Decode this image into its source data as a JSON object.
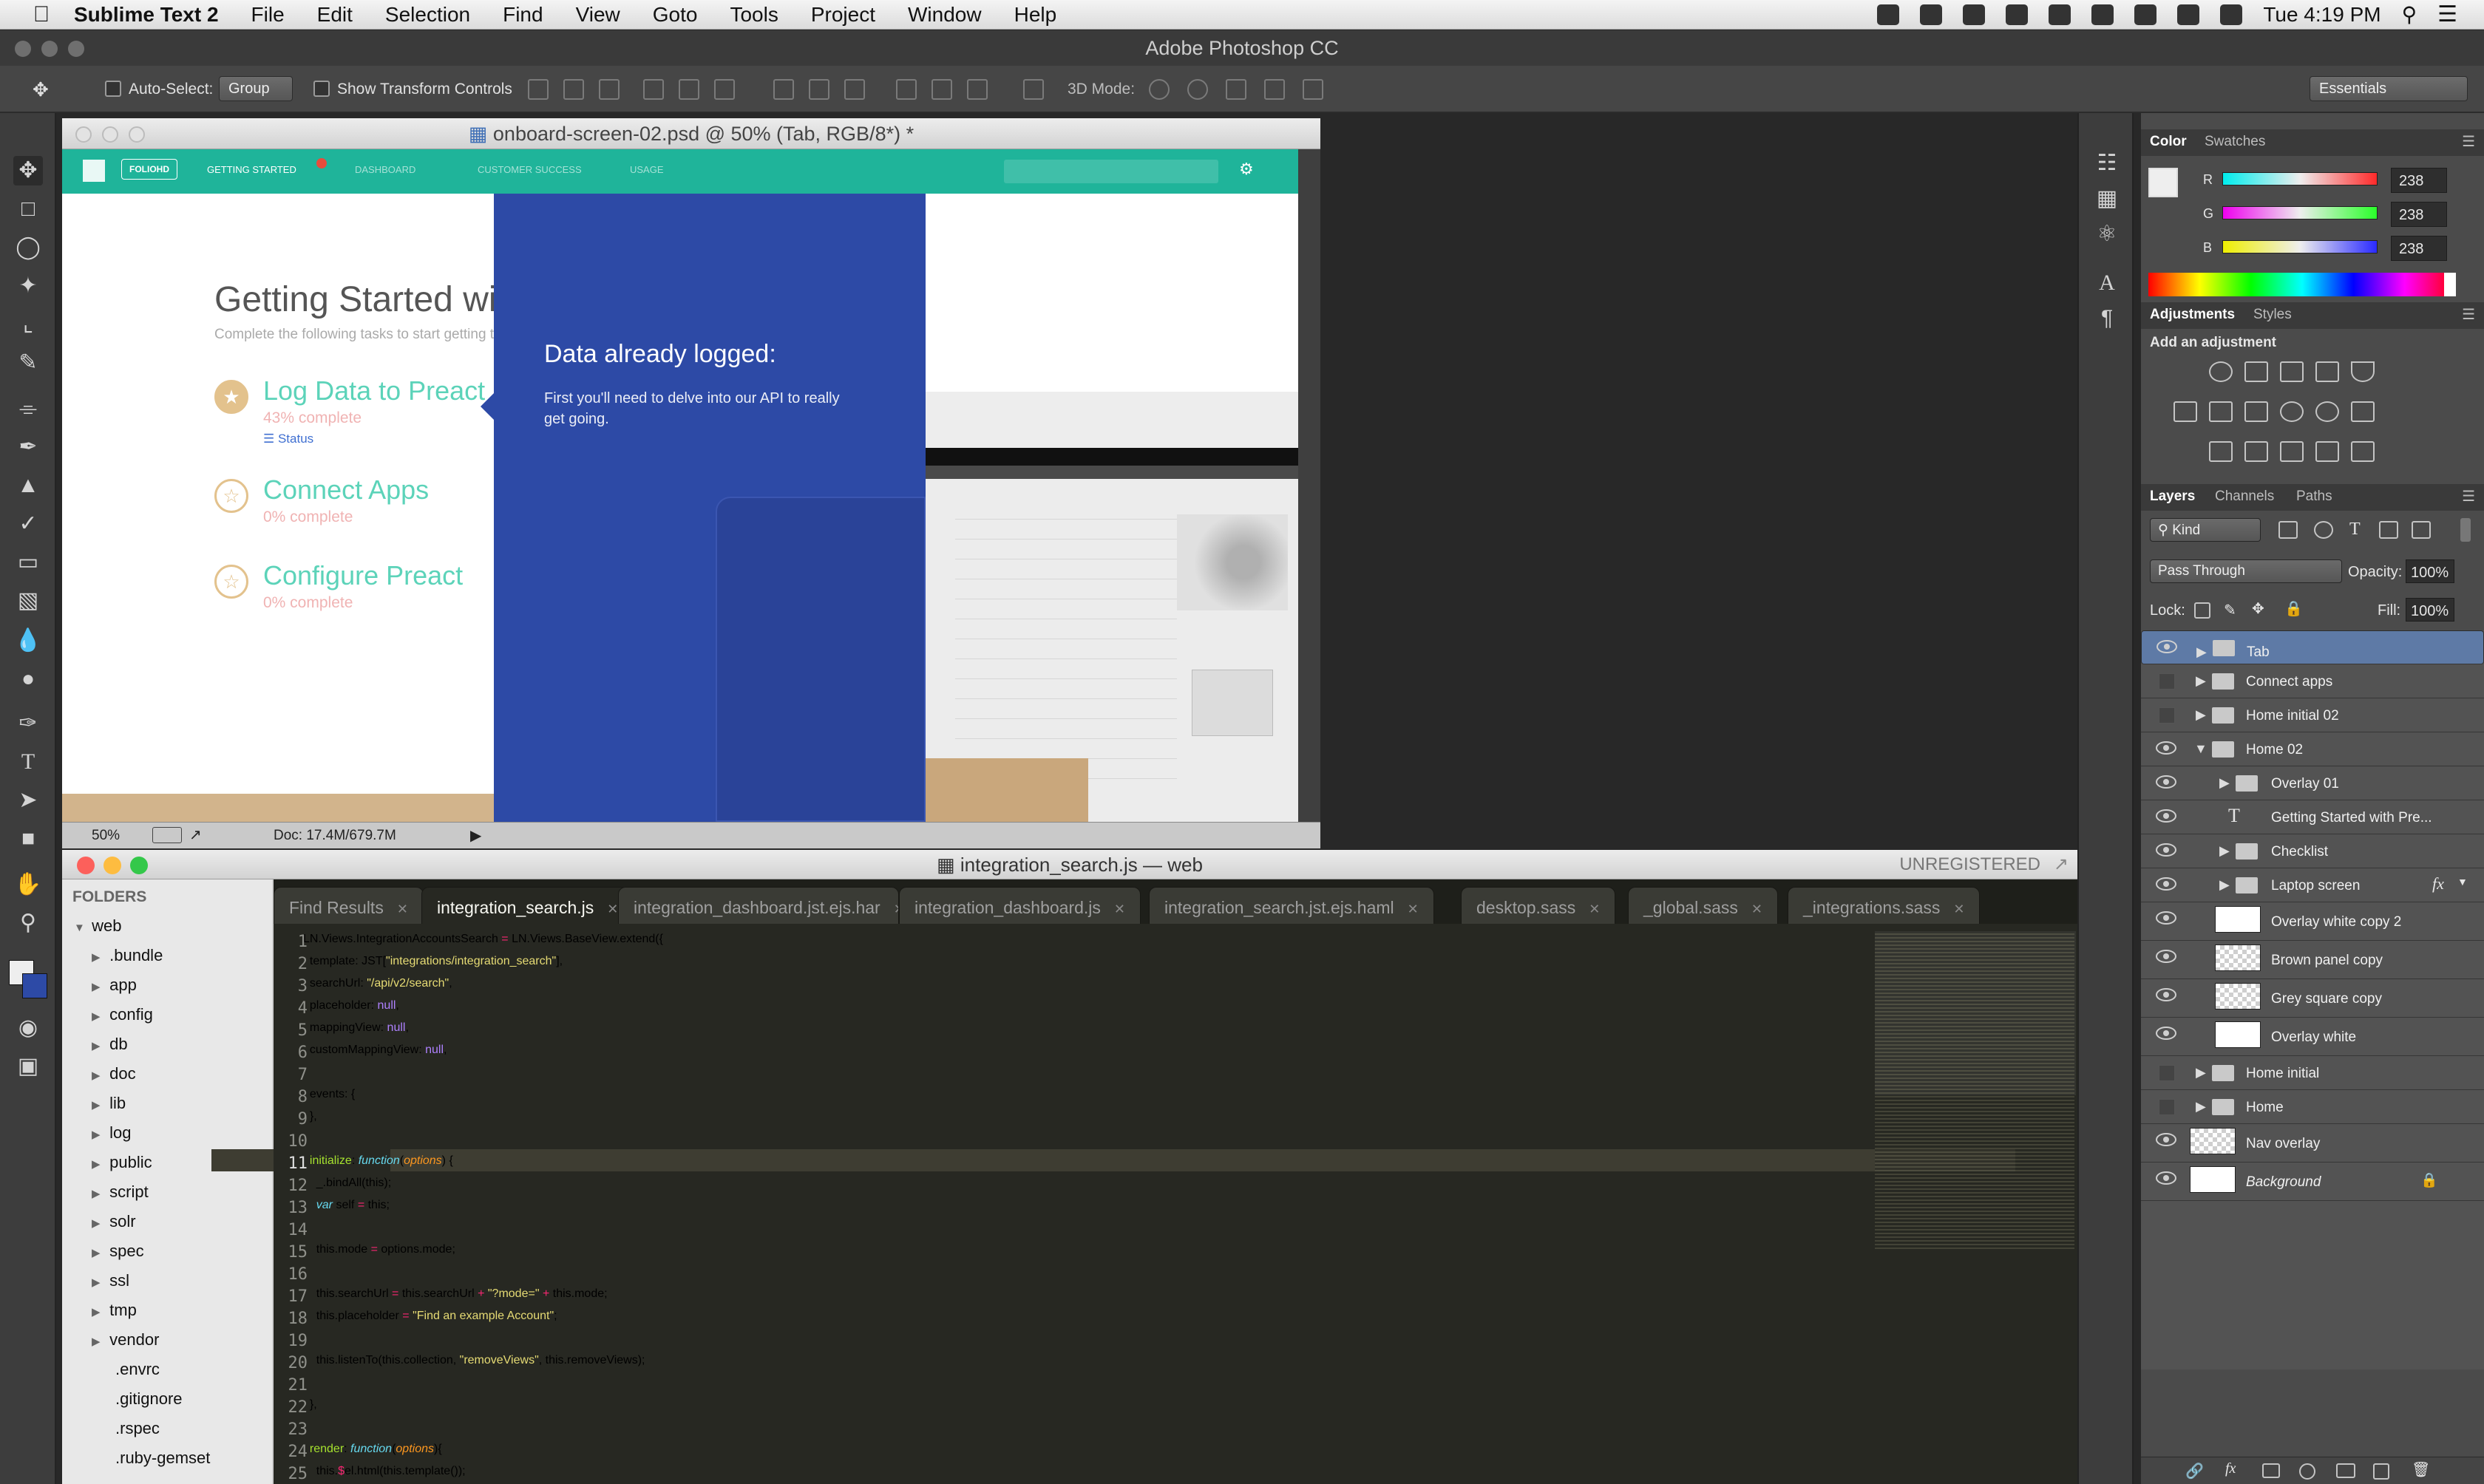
{
  "menubar": {
    "app_name": "Sublime Text 2",
    "items": [
      "File",
      "Edit",
      "Selection",
      "Find",
      "View",
      "Goto",
      "Tools",
      "Project",
      "Window",
      "Help"
    ],
    "clock": "Tue 4:19 PM"
  },
  "photoshop": {
    "window_title": "Adobe Photoshop CC",
    "options": {
      "auto_select_label": "Auto-Select:",
      "auto_select_value": "Group",
      "show_transform_label": "Show Transform Controls",
      "mode_3d_label": "3D Mode:",
      "workspace": "Essentials"
    },
    "document": {
      "title": "onboard-screen-02.psd @ 50% (Tab, RGB/8*) *",
      "zoom": "50%",
      "doc_size": "Doc: 17.4M/679.7M"
    },
    "design": {
      "nav_logo": "FOLIOHD",
      "nav_tabs": [
        "GETTING STARTED",
        "DASHBOARD",
        "CUSTOMER SUCCESS",
        "USAGE"
      ],
      "heading": "Getting Started with Preact",
      "subheading": "Complete the following tasks to start getting the m",
      "tasks": [
        {
          "title": "Log Data to Preact",
          "progress": "43% complete",
          "link": "Status"
        },
        {
          "title": "Connect Apps",
          "progress": "0% complete"
        },
        {
          "title": "Configure Preact",
          "progress": "0% complete"
        }
      ],
      "panel_title": "Data already logged:",
      "panel_text_1": "First you'll need to delve into our API to really",
      "panel_text_2": "get going."
    },
    "color_panel": {
      "tabs": [
        "Color",
        "Swatches"
      ],
      "r": "238",
      "g": "238",
      "b": "238",
      "r_label": "R",
      "g_label": "G",
      "b_label": "B"
    },
    "adjustments_panel": {
      "tabs": [
        "Adjustments",
        "Styles"
      ],
      "add_label": "Add an adjustment"
    },
    "layers_panel": {
      "tabs": [
        "Layers",
        "Channels",
        "Paths"
      ],
      "kind_filter": "Kind",
      "blend_mode": "Pass Through",
      "opacity_label": "Opacity:",
      "opacity": "100%",
      "lock_label": "Lock:",
      "fill_label": "Fill:",
      "fill": "100%",
      "layers": [
        {
          "name": "Tab"
        },
        {
          "name": "Connect apps"
        },
        {
          "name": "Home initial 02"
        },
        {
          "name": "Home 02"
        },
        {
          "name": "Overlay 01"
        },
        {
          "name": "Getting Started with Pre..."
        },
        {
          "name": "Checklist"
        },
        {
          "name": "Laptop screen"
        },
        {
          "name": "Overlay white copy 2"
        },
        {
          "name": "Brown panel copy"
        },
        {
          "name": "Grey square copy"
        },
        {
          "name": "Overlay white"
        },
        {
          "name": "Home initial"
        },
        {
          "name": "Home"
        },
        {
          "name": "Nav overlay"
        },
        {
          "name": "Background"
        }
      ]
    }
  },
  "sublime": {
    "window_title": "integration_search.js — web",
    "registration": "UNREGISTERED",
    "sidebar_header": "FOLDERS",
    "root_folder": "web",
    "folders": [
      ".bundle",
      "app",
      "config",
      "db",
      "doc",
      "lib",
      "log",
      "public",
      "script",
      "solr",
      "spec",
      "ssl",
      "tmp",
      "vendor"
    ],
    "files": [
      ".envrc",
      ".gitignore",
      ".rspec",
      ".ruby-gemset"
    ],
    "tabs": [
      "Find Results",
      "integration_search.js",
      "integration_dashboard.jst.ejs.har",
      "integration_dashboard.js",
      "integration_search.jst.ejs.haml",
      "desktop.sass",
      "_global.sass",
      "_integrations.sass"
    ],
    "line_numbers": [
      "1",
      "2",
      "3",
      "4",
      "5",
      "6",
      "7",
      "8",
      "9",
      "10",
      "11",
      "12",
      "13",
      "14",
      "15",
      "16",
      "17",
      "18",
      "19",
      "20",
      "21",
      "22",
      "23",
      "24",
      "25"
    ],
    "code": {
      "l1a": "LN.Views.IntegrationAccountsSearch ",
      "l1b": "=",
      "l1c": " LN.Views.BaseView.extend({",
      "l2a": "  template: JST[",
      "l2b": "\"integrations/integration_search\"",
      "l2c": "],",
      "l3a": "  searchUrl: ",
      "l3b": "\"/api/v2/search\"",
      "l3c": ",",
      "l4a": "  placeholder: ",
      "l4b": "null",
      "l4c": ",",
      "l5a": "  mappingView: ",
      "l5b": "null",
      "l5c": ",",
      "l6a": "  customMappingView: ",
      "l6b": "null",
      "l6c": ",",
      "l8": "  events: {",
      "l9": "  },",
      "l11a": "  initialize",
      "l11b": ": ",
      "l11c": "function",
      "l11d": "(",
      "l11e": "options",
      "l11f": ") {",
      "l12": "    _.bindAll(this);",
      "l13a": "    ",
      "l13b": "var",
      "l13c": " self ",
      "l13d": "=",
      "l13e": " this;",
      "l15a": "    this.mode ",
      "l15b": "=",
      "l15c": " options.mode;",
      "l17a": "    this.searchUrl ",
      "l17b": "=",
      "l17c": " this.searchUrl ",
      "l17d": "+",
      "l17e": " ",
      "l17f": "\"?mode=\"",
      "l17g": " ",
      "l17h": "+",
      "l17i": " this.mode;",
      "l18a": "    this.placeholder ",
      "l18b": "=",
      "l18c": " ",
      "l18d": "\"Find an example Account\"",
      "l18e": ";",
      "l20a": "    this.listenTo(this.collection, ",
      "l20b": "\"removeViews\"",
      "l20c": ", this.removeViews);",
      "l22": "  },",
      "l24a": "  render",
      "l24b": ": ",
      "l24c": "function",
      "l24d": "(",
      "l24e": "options",
      "l24f": "){",
      "l25a": "    this.",
      "l25b": "$",
      "l25c": "el.html(this.template());"
    }
  },
  "colors": {
    "teal": "#1fb49a",
    "blue_panel": "#2d4aa6",
    "monokai_bg": "#272822",
    "layer_selected": "#5e7aa6"
  }
}
